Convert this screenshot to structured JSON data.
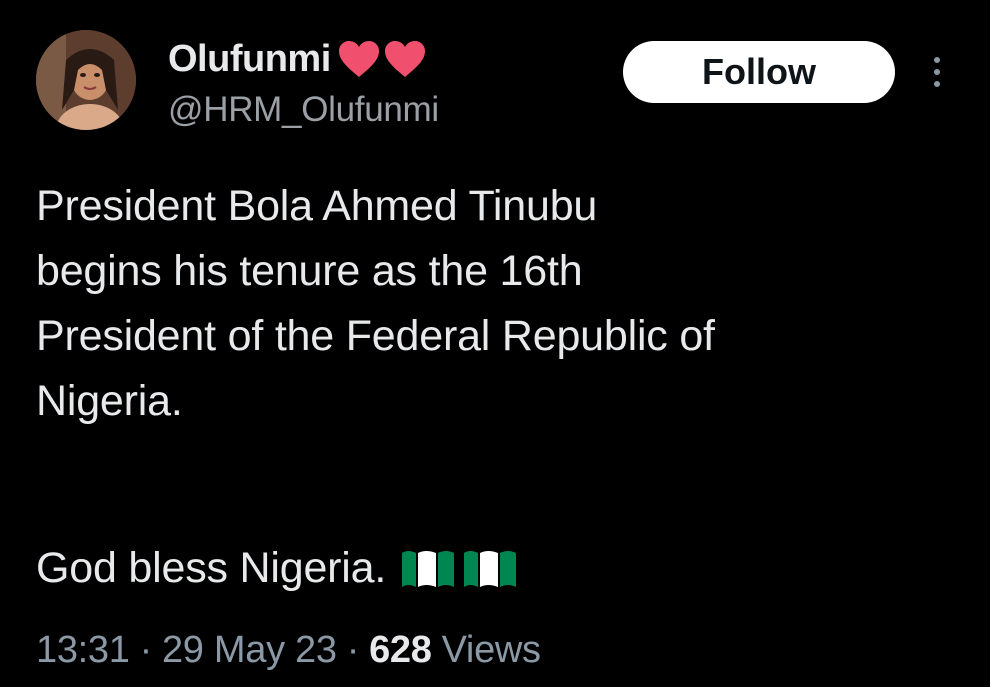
{
  "author": {
    "display_name": "Olufunmi",
    "handle": "@HRM_Olufunmi",
    "name_emoji": [
      "heart-icon",
      "heart-icon"
    ],
    "heart_color": "#f0506e"
  },
  "actions": {
    "follow_label": "Follow",
    "more_icon": "more-vertical-icon"
  },
  "tweet": {
    "lines": [
      "President Bola Ahmed Tinubu",
      "begins his tenure as the 16th",
      "President of the Federal Republic of",
      "Nigeria."
    ],
    "blessing": "God bless Nigeria.",
    "blessing_emoji": [
      "nigeria-flag-icon",
      "nigeria-flag-icon"
    ],
    "flag_colors": [
      "#008751",
      "#ffffff",
      "#008751"
    ]
  },
  "meta": {
    "time": "13:31",
    "date": "29 May 23",
    "separator": "·",
    "views_count": "628",
    "views_label": "Views"
  },
  "colors": {
    "background": "#000000",
    "primary_text": "#e7e9ea",
    "secondary_text": "#8b98a5",
    "follow_bg": "#ffffff",
    "follow_text": "#0f1419"
  }
}
